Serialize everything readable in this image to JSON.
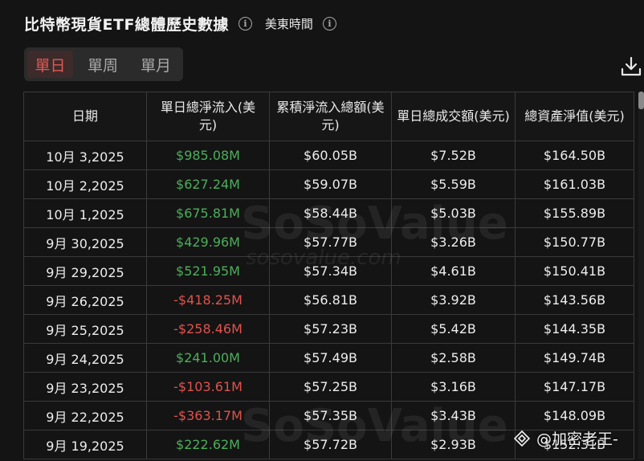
{
  "header": {
    "title": "比特幣現貨ETF總體歷史數據",
    "timezone_label": "美東時間"
  },
  "segments": {
    "day": "單日",
    "week": "單周",
    "month": "單月",
    "active_color": "#e05a55"
  },
  "table": {
    "headers": {
      "date": "日期",
      "daily_net_inflow": "單日總淨流入(美元)",
      "cumulative_net_inflow": "累積淨流入總額(美元)",
      "daily_volume": "單日總成交額(美元)",
      "total_net_assets": "總資產淨值(美元)"
    },
    "rows": [
      {
        "date": "10月 3,2025",
        "inflow": "$985.08M",
        "cum": "$60.05B",
        "vol": "$7.52B",
        "nav": "$164.50B"
      },
      {
        "date": "10月 2,2025",
        "inflow": "$627.24M",
        "cum": "$59.07B",
        "vol": "$5.59B",
        "nav": "$161.03B"
      },
      {
        "date": "10月 1,2025",
        "inflow": "$675.81M",
        "cum": "$58.44B",
        "vol": "$5.03B",
        "nav": "$155.89B"
      },
      {
        "date": "9月 30,2025",
        "inflow": "$429.96M",
        "cum": "$57.77B",
        "vol": "$3.26B",
        "nav": "$150.77B"
      },
      {
        "date": "9月 29,2025",
        "inflow": "$521.95M",
        "cum": "$57.34B",
        "vol": "$4.61B",
        "nav": "$150.41B"
      },
      {
        "date": "9月 26,2025",
        "inflow": "-$418.25M",
        "cum": "$56.81B",
        "vol": "$3.92B",
        "nav": "$143.56B"
      },
      {
        "date": "9月 25,2025",
        "inflow": "-$258.46M",
        "cum": "$57.23B",
        "vol": "$5.42B",
        "nav": "$144.35B"
      },
      {
        "date": "9月 24,2025",
        "inflow": "$241.00M",
        "cum": "$57.49B",
        "vol": "$2.58B",
        "nav": "$149.74B"
      },
      {
        "date": "9月 23,2025",
        "inflow": "-$103.61M",
        "cum": "$57.25B",
        "vol": "$3.16B",
        "nav": "$147.17B"
      },
      {
        "date": "9月 22,2025",
        "inflow": "-$363.17M",
        "cum": "$57.35B",
        "vol": "$3.43B",
        "nav": "$148.09B"
      },
      {
        "date": "9月 19,2025",
        "inflow": "$222.62M",
        "cum": "$57.72B",
        "vol": "$2.93B",
        "nav": "$152.31B"
      }
    ],
    "positive_color": "#4cae5a",
    "negative_color": "#e0524d"
  },
  "watermark": {
    "brand": "SoSoValue",
    "site": "sosovalue.com"
  },
  "credit": {
    "text": "@加密老王-"
  },
  "icons": {
    "info": "info-icon",
    "download": "download-icon",
    "credit_logo": "diamond-logo-icon"
  }
}
